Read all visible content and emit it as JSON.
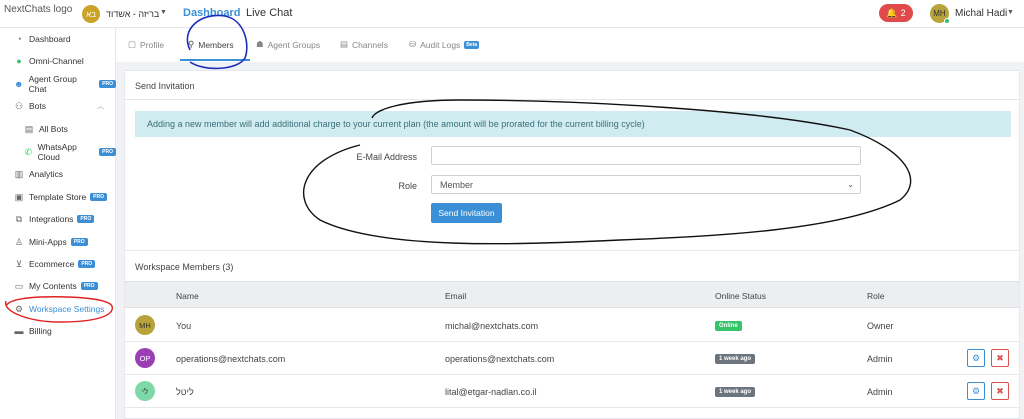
{
  "topbar": {
    "logo_alt": "NextChats logo",
    "workspace_initials": "בא",
    "workspace_name": "בריזה - אשדוד",
    "nav": [
      "Dashboard",
      "Live Chat"
    ],
    "notifications_count": "2",
    "user_initials": "MH",
    "user_name": "Michal Hadi"
  },
  "sidebar": {
    "items": [
      {
        "label": "Dashboard",
        "icon": "dashboard-icon"
      },
      {
        "label": "Omni-Channel",
        "icon": "chat-icon"
      },
      {
        "label": "Agent Group Chat",
        "icon": "agent-icon",
        "pro": "PRO"
      },
      {
        "label": "Bots",
        "icon": "bots-icon"
      },
      {
        "label": "All Bots",
        "icon": "list-icon"
      },
      {
        "label": "WhatsApp Cloud",
        "icon": "whatsapp-icon",
        "pro": "PRO"
      },
      {
        "label": "Analytics",
        "icon": "analytics-icon"
      },
      {
        "label": "Template Store",
        "icon": "store-icon",
        "pro": "PRO"
      },
      {
        "label": "Integrations",
        "icon": "integrations-icon",
        "pro": "PRO"
      },
      {
        "label": "Mini-Apps",
        "icon": "mini-apps-icon",
        "pro": "PRO"
      },
      {
        "label": "Ecommerce",
        "icon": "cart-icon",
        "pro": "PRO"
      },
      {
        "label": "My Contents",
        "icon": "document-icon",
        "pro": "PRO"
      },
      {
        "label": "Workspace Settings",
        "icon": "gear-icon"
      },
      {
        "label": "Billing",
        "icon": "billing-icon"
      }
    ]
  },
  "tabs": {
    "items": [
      "Profile",
      "Members",
      "Agent Groups",
      "Channels",
      "Audit Logs"
    ],
    "beta": "Beta"
  },
  "invite": {
    "title": "Send Invitation",
    "alert": "Adding a new member will add additional charge to your current plan (the amount will be prorated for the current billing cycle)",
    "email_label": "E-Mail Address",
    "email_value": "",
    "role_label": "Role",
    "role_value": "Member",
    "send_label": "Send Invitation"
  },
  "members": {
    "title": "Workspace Members (3)",
    "headers": [
      "Name",
      "Email",
      "Online Status",
      "Role"
    ],
    "rows": [
      {
        "initials": "MH",
        "name": "You",
        "email": "michal@nextchats.com",
        "status": "Online",
        "role": "Owner"
      },
      {
        "initials": "OP",
        "name": "operations@nextchats.com",
        "email": "operations@nextchats.com",
        "status": "1 week ago",
        "role": "Admin"
      },
      {
        "initials": "לי",
        "name": "ליטל",
        "email": "lital@etgar-nadlan.co.il",
        "status": "1 week ago",
        "role": "Admin"
      }
    ]
  },
  "colors": {
    "accent": "#3a8fd6",
    "online": "#36c46a",
    "offline": "#6c757d",
    "danger": "#d9534f",
    "annotation_blue": "#1c2fb8",
    "annotation_red": "#e02020"
  }
}
